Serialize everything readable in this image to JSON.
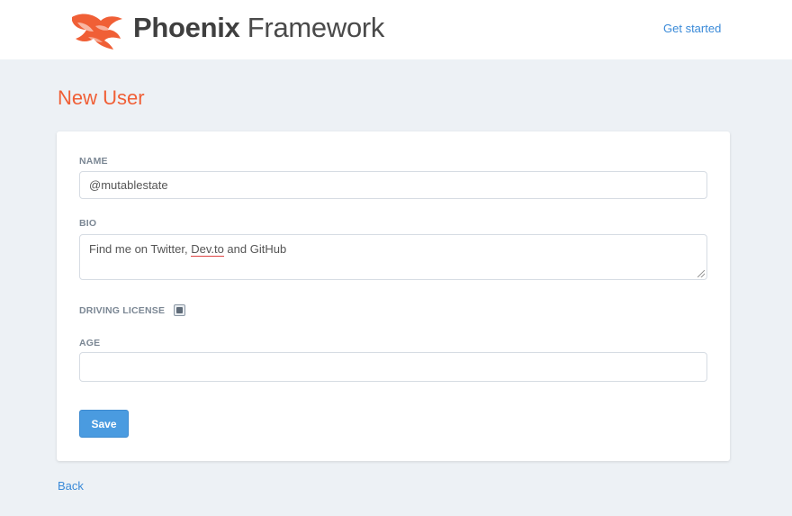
{
  "header": {
    "logo_bold": "Phoenix",
    "logo_light": " Framework",
    "nav_link": "Get started"
  },
  "page": {
    "title": "New User",
    "back_link": "Back"
  },
  "form": {
    "name_label": "NAME",
    "name_value": "@mutablestate",
    "bio_label": "BIO",
    "bio_prefix": "Find me on Twitter, ",
    "bio_link_word": "Dev.to",
    "bio_suffix": " and GitHub",
    "driving_license_label": "DRIVING LICENSE",
    "driving_license_checked": true,
    "age_label": "AGE",
    "age_value": "",
    "save_label": "Save"
  },
  "colors": {
    "accent_orange": "#f05f36",
    "link_blue": "#3a8ad8",
    "button_blue": "#4a9be0",
    "background": "#edf1f5"
  },
  "icons": {
    "logo": "phoenix-bird-icon",
    "checkbox": "checkbox-checked-icon",
    "resize": "resize-grip-icon"
  }
}
